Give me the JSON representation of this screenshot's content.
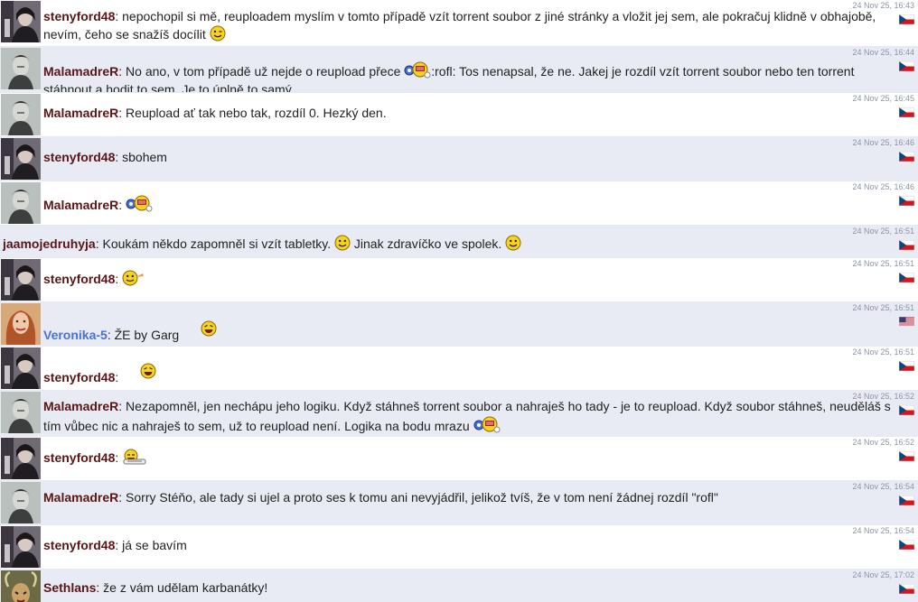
{
  "messages": [
    {
      "nick": "stenyford48",
      "avatar": "stenyford48-avatar",
      "sep": ":",
      "parts": [
        " nepochopil si mě, reuploadem myslím v tomto případě vzít torrent soubor z jiné stránky a vložit jej sem, ale pokračuj klidně v obhajobě, nevím, čeho se snažíš docílit "
      ],
      "ts": "24 Nov 25, 16:43",
      "flag": "cz"
    },
    {
      "nick": "MalamadreR",
      "avatar": "malamadre-avatar",
      "sep": ":",
      "parts": [
        " No ano, v tom případě už nejde o reupload přece ",
        ":rofl: Tos nenapsal, že ne. Jakej je rozdíl vzít torrent soubor nebo ten torrent stáhnout a hodit to sem. Je to úplně to samý."
      ],
      "ts": "24 Nov 25, 16:44",
      "flag": "cz"
    },
    {
      "nick": "MalamadreR",
      "avatar": "malamadre-avatar",
      "sep": ":",
      "parts": [
        " Reupload ať tak nebo tak, rozdíl 0. Hezký den."
      ],
      "ts": "24 Nov 25, 16:45",
      "flag": "cz"
    },
    {
      "nick": "stenyford48",
      "avatar": "stenyford48-avatar",
      "sep": ":",
      "parts": [
        " sbohem"
      ],
      "ts": "24 Nov 25, 16:46",
      "flag": "cz"
    },
    {
      "nick": "MalamadreR",
      "avatar": "malamadre-avatar",
      "sep": ":",
      "parts": [
        " "
      ],
      "ts": "24 Nov 25, 16:46",
      "flag": "cz"
    },
    {
      "nick": "jaamojedruhyja",
      "avatar": "",
      "sep": ":",
      "parts": [
        " Koukám někdo zapomněl si vzít tabletky. ",
        " Jinak zdravíčko ve spolek. "
      ],
      "ts": "24 Nov 25, 16:51",
      "flag": "cz"
    },
    {
      "nick": "stenyford48",
      "avatar": "stenyford48-avatar",
      "sep": ":",
      "parts": [
        " "
      ],
      "ts": "24 Nov 25, 16:51",
      "flag": "cz"
    },
    {
      "nick": "Veronika-5",
      "avatar": "veronika-avatar",
      "sep": ":",
      "parts": [
        " ŽE by Garg "
      ],
      "ts": "24 Nov 25, 16:51",
      "flag": "us"
    },
    {
      "nick": "stenyford48",
      "avatar": "stenyford48-avatar",
      "sep": ":",
      "parts": [
        " "
      ],
      "ts": "24 Nov 25, 16:51",
      "flag": "cz"
    },
    {
      "nick": "MalamadreR",
      "avatar": "malamadre-avatar",
      "sep": ":",
      "parts": [
        " Nezapomněl, jen nechápu jeho logiku. Když stáhneš torrent soubor a nahraješ ho tady - je to reupload. Když soubor stáhneš, neuděláš s tím vůbec nic a nahraješ to sem, už to reupload není. Logika na bodu mrazu "
      ],
      "ts": "24 Nov 25, 16:52",
      "flag": "cz"
    },
    {
      "nick": "stenyford48",
      "avatar": "stenyford48-avatar",
      "sep": ":",
      "parts": [
        " "
      ],
      "ts": "24 Nov 25, 16:52",
      "flag": "cz"
    },
    {
      "nick": "MalamadreR",
      "avatar": "malamadre-avatar",
      "sep": ":",
      "parts": [
        " Sorry Stéňo, ale tady si ujel a proto ses k tomu ani nevyjádřil, jelikož tvíš, že v tom není žádnej rozdíl \"rofl\""
      ],
      "ts": "24 Nov 25, 16:54",
      "flag": "cz"
    },
    {
      "nick": "stenyford48",
      "avatar": "stenyford48-avatar",
      "sep": ":",
      "parts": [
        " já se bavím"
      ],
      "ts": "24 Nov 25, 16:54",
      "flag": "cz"
    },
    {
      "nick": "Sethlans",
      "avatar": "sethlans-avatar",
      "sep": ":",
      "parts": [
        " že z vám udělam karbanátky!"
      ],
      "ts": "24 Nov 25, 17:02",
      "flag": "cz"
    }
  ],
  "icons": {
    "wink": "wink-smiley-icon",
    "rofl": "rofl-smiley-icon",
    "smile": "smile-smiley-icon",
    "tongue": "tongue-smiley-icon",
    "laugh": "laugh-smiley-icon",
    "lol": "lol-smiley-icon",
    "cz_flag": "czech-flag-icon",
    "us_flag": "usa-flag-icon"
  },
  "colors": {
    "nick": "#5a1616",
    "nick_highlight": "#4a6fd8",
    "row_alt": "#e8ebf3",
    "timestamp": "#8c94a8"
  }
}
